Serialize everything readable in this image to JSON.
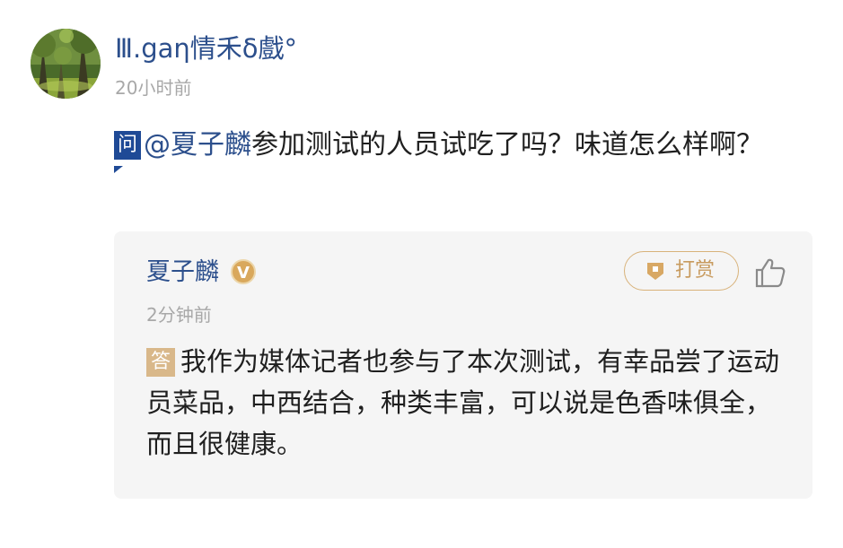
{
  "post": {
    "username": "Ⅲ.gaη情禾δ戲°",
    "time": "20小时前",
    "question_badge": "问",
    "mention": "@夏子麟",
    "question_text": "参加测试的人员试吃了吗？味道怎么样啊？"
  },
  "answer": {
    "answerer": "夏子麟",
    "verified_badge": "V",
    "tip_label": "打赏",
    "time": "2分钟前",
    "answer_badge": "答",
    "answer_text": "我作为媒体记者也参与了本次测试，有幸品尝了运动员菜品，中西结合，种类丰富，可以说是色香味俱全，而且很健康。"
  },
  "colors": {
    "link": "#2c4f8c",
    "question_badge": "#1f4a96",
    "answer_badge": "#d9b88a",
    "tip_accent": "#c89b5f",
    "muted": "#a8a8a8",
    "card_bg": "#f5f5f5"
  },
  "icons": {
    "avatar": "forest-avatar",
    "tip": "gift-tag-icon",
    "like": "thumbs-up-icon"
  }
}
